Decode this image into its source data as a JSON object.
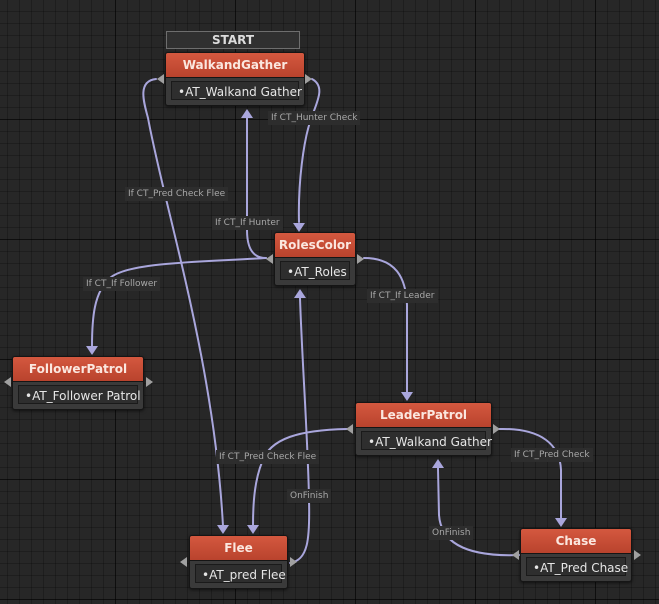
{
  "start_label": "START",
  "nodes": {
    "walkand_gather": {
      "title": "WalkandGather",
      "action": "•AT_Walkand Gather"
    },
    "roles_color": {
      "title": "RolesColor",
      "action": "•AT_Roles"
    },
    "follower_patrol": {
      "title": "FollowerPatrol",
      "action": "•AT_Follower Patrol"
    },
    "leader_patrol": {
      "title": "LeaderPatrol",
      "action": "•AT_Walkand Gather"
    },
    "flee": {
      "title": "Flee",
      "action": "•AT_pred Flee"
    },
    "chase": {
      "title": "Chase",
      "action": "•AT_Pred Chase"
    }
  },
  "transitions": {
    "hunter_check": "If CT_Hunter Check",
    "if_hunter": "If CT_If Hunter",
    "pred_check_flee_top": "If CT_Pred Check Flee",
    "if_follower": "If CT_If Follower",
    "if_leader": "If CT_If Leader",
    "pred_check_flee_low": "If CT_Pred Check Flee",
    "pred_check": "If CT_Pred Check",
    "on_finish_flee": "OnFinish",
    "on_finish_chase": "OnFinish"
  }
}
